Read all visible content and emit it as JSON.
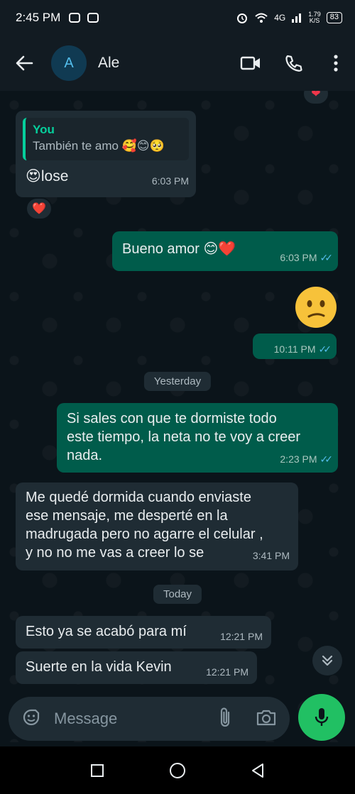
{
  "status_bar": {
    "time": "2:45 PM",
    "network": "4G",
    "speed_value": "1.79",
    "speed_unit": "K/S",
    "battery": "83"
  },
  "header": {
    "avatar_letter": "A",
    "contact_name": "Ale"
  },
  "messages": [
    {
      "id": "m1",
      "direction": "in",
      "quote_author": "You",
      "quote_text": "También te amo 🥰😊🥺",
      "text": "😍lose",
      "time": "6:03 PM",
      "reaction": "❤️"
    },
    {
      "id": "m2",
      "direction": "out",
      "text": "Bueno amor 😊❤️",
      "time": "6:03 PM",
      "read": true
    },
    {
      "id": "m3",
      "direction": "out",
      "emoji": "😕",
      "time": "10:11 PM",
      "read": true
    },
    {
      "id": "m4",
      "direction": "out",
      "lines": [
        "Si sales con que te dormiste todo",
        "este tiempo, la neta no te voy a creer",
        "nada."
      ],
      "time": "2:23 PM",
      "read": true
    },
    {
      "id": "m5",
      "direction": "in",
      "lines": [
        "Me quedé dormida cuando enviaste",
        "ese mensaje, me desperté en la",
        "madrugada pero no agarre el celular ,",
        "y no no me vas a creer lo se"
      ],
      "time": "3:41 PM"
    },
    {
      "id": "m6",
      "direction": "in",
      "text": "Esto ya se acabó para mí",
      "time": "12:21 PM"
    },
    {
      "id": "m7",
      "direction": "in",
      "text": "Suerte en la vida Kevin",
      "time": "12:21 PM"
    }
  ],
  "date_separators": {
    "yesterday": "Yesterday",
    "today": "Today"
  },
  "composer": {
    "placeholder": "Message"
  },
  "colors": {
    "background": "#0b141a",
    "incoming_bubble": "#1f2c34",
    "outgoing_bubble": "#005c4b",
    "accent_green": "#21c063",
    "read_ticks": "#53bdeb"
  }
}
